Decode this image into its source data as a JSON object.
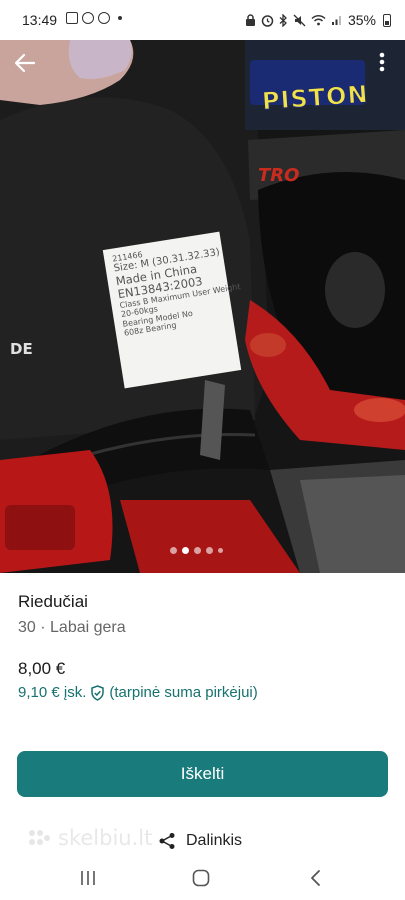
{
  "status_bar": {
    "time": "13:49",
    "battery": "35%"
  },
  "photo": {
    "label_lines": [
      "211466",
      "Size: M (30.31.32.33)",
      "Made in China",
      "EN13843:2003",
      "Class B Maximum User Weight",
      "20-60kgs",
      "Bearing Model No",
      "608z Bearing"
    ],
    "brand_text": "PISTON",
    "partial_text_1": "TRO",
    "partial_text_2": "DE",
    "image_count": 5,
    "active_index": 1
  },
  "listing": {
    "title": "Riedučiai",
    "subtitle": "30 · Labai gera",
    "price": "8,00 €",
    "price_with_fee": "9,10 € įsk.",
    "fee_note": "(tarpinė suma pirkėjui)"
  },
  "actions": {
    "promote_label": "Iškelti",
    "share_label": "Dalinkis",
    "watermark": "skelbiu.lt"
  },
  "colors": {
    "accent": "#1a7b7c",
    "price_fee": "#17726f"
  }
}
